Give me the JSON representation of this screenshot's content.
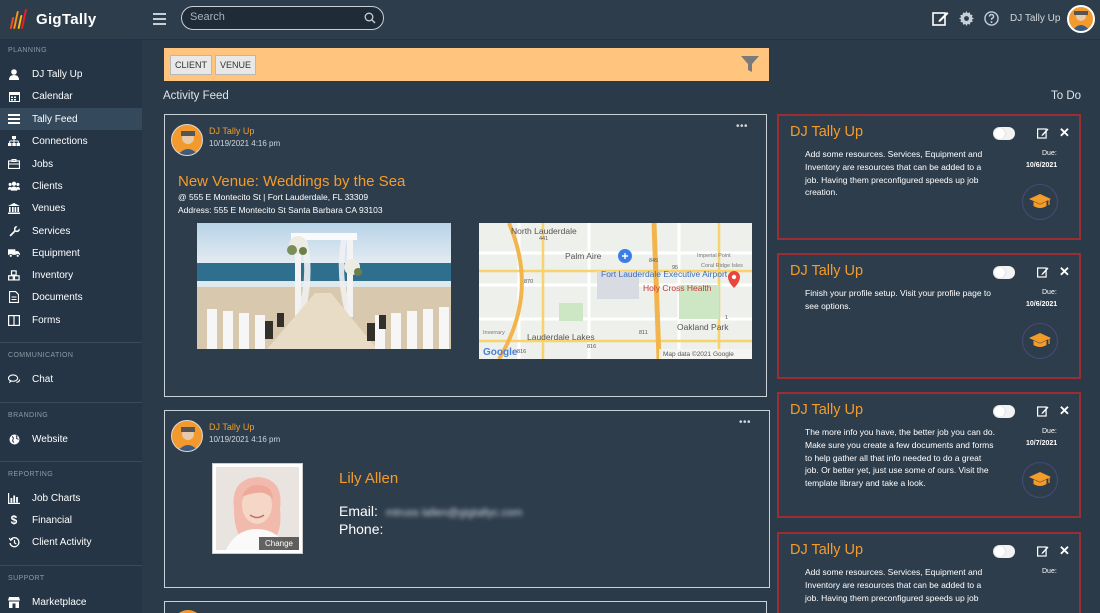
{
  "app": {
    "name": "GigTally"
  },
  "header": {
    "search_placeholder": "Search",
    "user_name": "DJ Tally Up"
  },
  "sidebar": {
    "sections": [
      {
        "label": "PLANNING"
      },
      {
        "label": "COMMUNICATION"
      },
      {
        "label": "BRANDING"
      },
      {
        "label": "REPORTING"
      },
      {
        "label": "SUPPORT"
      }
    ],
    "items": [
      {
        "label": "DJ Tally Up",
        "icon": "user-icon"
      },
      {
        "label": "Calendar",
        "icon": "calendar-icon"
      },
      {
        "label": "Tally Feed",
        "icon": "feed-icon",
        "active": true
      },
      {
        "label": "Connections",
        "icon": "sitemap-icon"
      },
      {
        "label": "Jobs",
        "icon": "briefcase-icon"
      },
      {
        "label": "Clients",
        "icon": "users-icon"
      },
      {
        "label": "Venues",
        "icon": "bank-icon"
      },
      {
        "label": "Services",
        "icon": "wrench-icon"
      },
      {
        "label": "Equipment",
        "icon": "truck-icon"
      },
      {
        "label": "Inventory",
        "icon": "cubes-icon"
      },
      {
        "label": "Documents",
        "icon": "document-icon"
      },
      {
        "label": "Forms",
        "icon": "columns-icon"
      },
      {
        "label": "Chat",
        "icon": "chat-icon"
      },
      {
        "label": "Website",
        "icon": "globe-icon"
      },
      {
        "label": "Job Charts",
        "icon": "bar-chart-icon"
      },
      {
        "label": "Financial",
        "icon": "dollar-icon"
      },
      {
        "label": "Client Activity",
        "icon": "history-icon"
      },
      {
        "label": "Marketplace",
        "icon": "shop-icon"
      }
    ]
  },
  "filters": {
    "chips": [
      "CLIENT",
      "VENUE"
    ]
  },
  "feed": {
    "label": "Activity Feed",
    "posts": [
      {
        "author": "DJ Tally Up",
        "time": "10/19/2021 4:16 pm",
        "menu": "•••",
        "title": "New Venue: Weddings by the Sea",
        "line1": "@ 555 E Montecito St | Fort Lauderdale, FL 33309",
        "line2": "Address: 555 E Montecito St Santa Barbara CA 93103",
        "map": {
          "labels": [
            "North Lauderdale",
            "Palm Aire",
            "Fort Lauderdale Executive Airport",
            "Holy Cross Health",
            "Oakland Park",
            "Lauderdale Lakes",
            "Inverrary",
            "Imperial Point",
            "Coral Ridge Isles"
          ],
          "roads": [
            "441",
            "845",
            "95",
            "870",
            "816",
            "811",
            "1",
            "816"
          ],
          "brand": "Google",
          "copyright": "Map data ©2021 Google"
        }
      },
      {
        "author": "DJ Tally Up",
        "time": "10/19/2021 4:16 pm",
        "menu": "•••",
        "contact_name": "Lily Allen",
        "email_label": "Email:",
        "email_value": "mtruss lallen@gigtallyc.com",
        "phone_label": "Phone:",
        "change_label": "Change"
      }
    ]
  },
  "todo": {
    "label": "To Do",
    "due_label": "Due:",
    "items": [
      {
        "title": "DJ Tally Up",
        "text": "Add some resources. Services, Equipment and Inventory are resources that can be added to a job. Having them preconfigured speeds up job creation.",
        "due": "10/6/2021"
      },
      {
        "title": "DJ Tally Up",
        "text": "Finish your profile setup. Visit your profile page to see options.",
        "due": "10/6/2021"
      },
      {
        "title": "DJ Tally Up",
        "text": "The more info you have, the better job you can do. Make sure you create a few documents and forms to help gather all that info needed to do a great job. Or better yet, just use some of ours. Visit the template library and take a look.",
        "due": "10/7/2021"
      },
      {
        "title": "DJ Tally Up",
        "text": "Add some resources. Services, Equipment and Inventory are resources that can be added to a job. Having them preconfigured speeds up job",
        "due": ""
      }
    ]
  },
  "colors": {
    "accent": "#f49c2a",
    "filter_bar": "#ffc47e",
    "todo_border": "#9a2f33",
    "sidebar": "#253545"
  }
}
